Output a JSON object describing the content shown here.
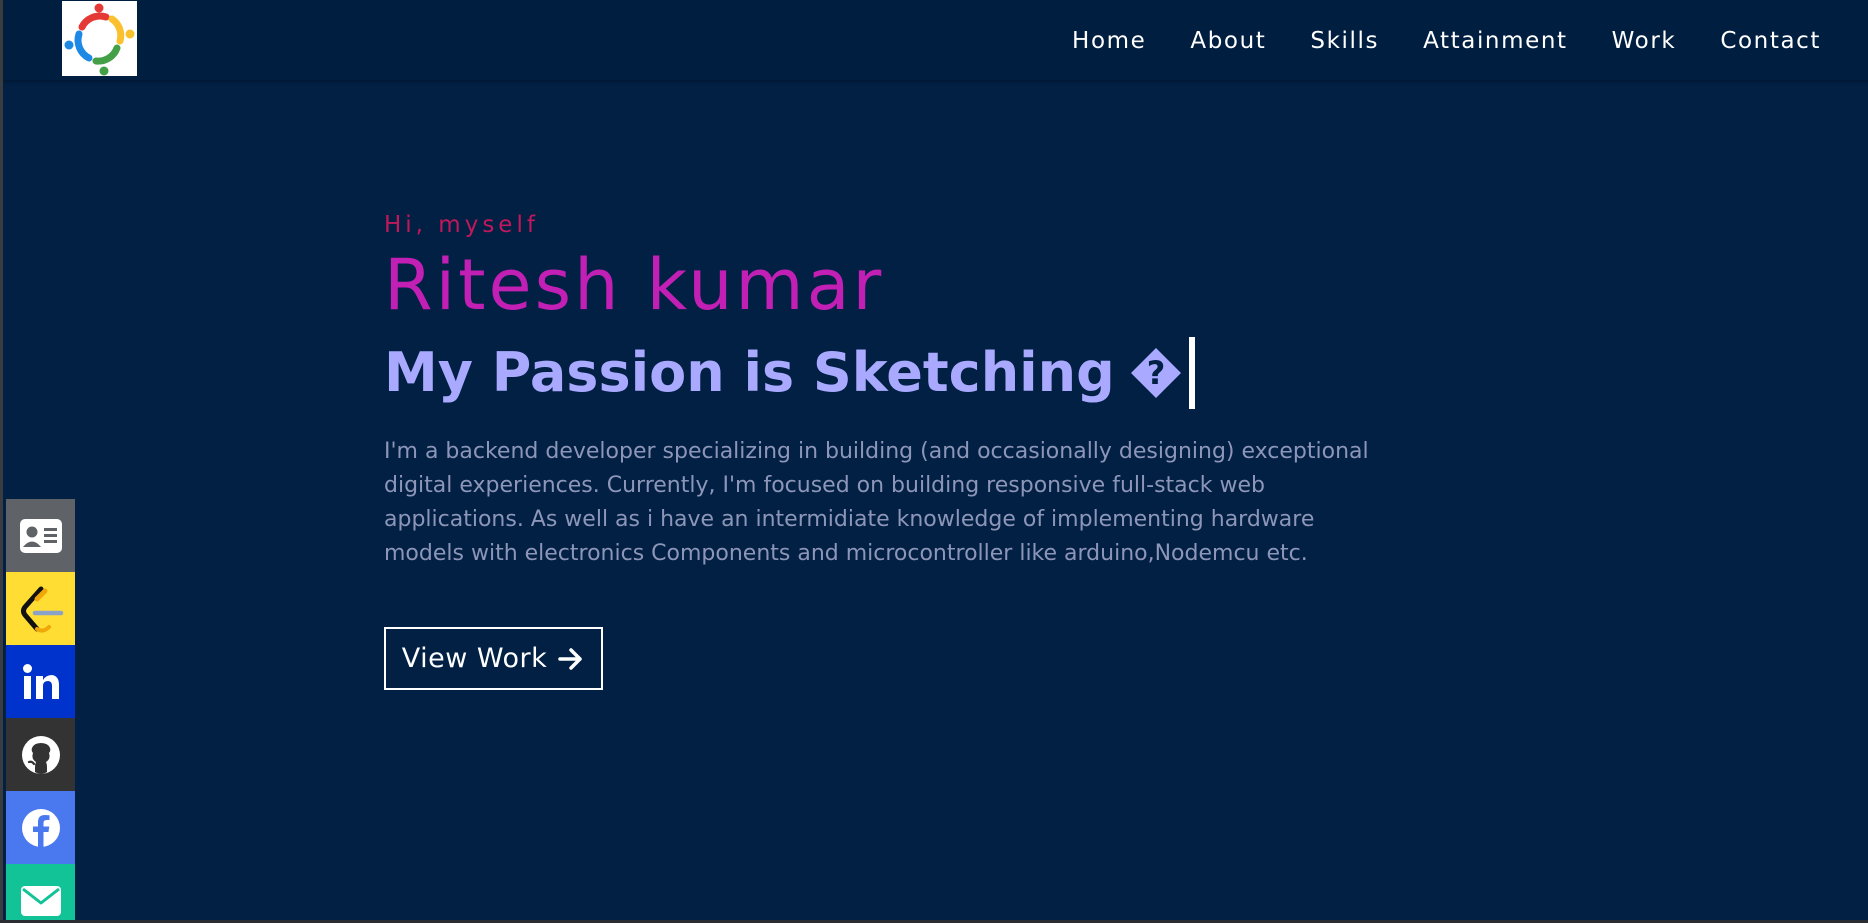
{
  "nav": {
    "links": [
      {
        "label": "Home"
      },
      {
        "label": "About"
      },
      {
        "label": "Skills"
      },
      {
        "label": "Attainment"
      },
      {
        "label": "Work"
      },
      {
        "label": "Contact"
      }
    ]
  },
  "hero": {
    "greeting": "Hi, myself",
    "name": "Ritesh kumar",
    "passion": "My Passion is Sketching",
    "passion_glyph": "?",
    "bio": "I'm a backend developer specializing in building (and occasionally designing) exceptional digital experiences. Currently, I'm focused on building responsive full-stack web applications. As well as i have an intermidiate knowledge of implementing hardware models with electronics Components and microcontroller like arduino,Nodemcu etc.",
    "cta_label": "View Work"
  },
  "social": [
    {
      "icon": "contact-card-icon",
      "color": "#5f6266"
    },
    {
      "icon": "leetcode-icon",
      "color": "#ffdd33"
    },
    {
      "icon": "linkedin-icon",
      "color": "#0033cc"
    },
    {
      "icon": "github-icon",
      "color": "#333333"
    },
    {
      "icon": "facebook-icon",
      "color": "#4a79ef"
    },
    {
      "icon": "mail-icon",
      "color": "#13c398"
    }
  ],
  "colors": {
    "background": "#012044",
    "greeting": "#c2185b",
    "name": "#c21fb4",
    "passion": "#a8a9ff",
    "bio": "#8d96b8"
  }
}
